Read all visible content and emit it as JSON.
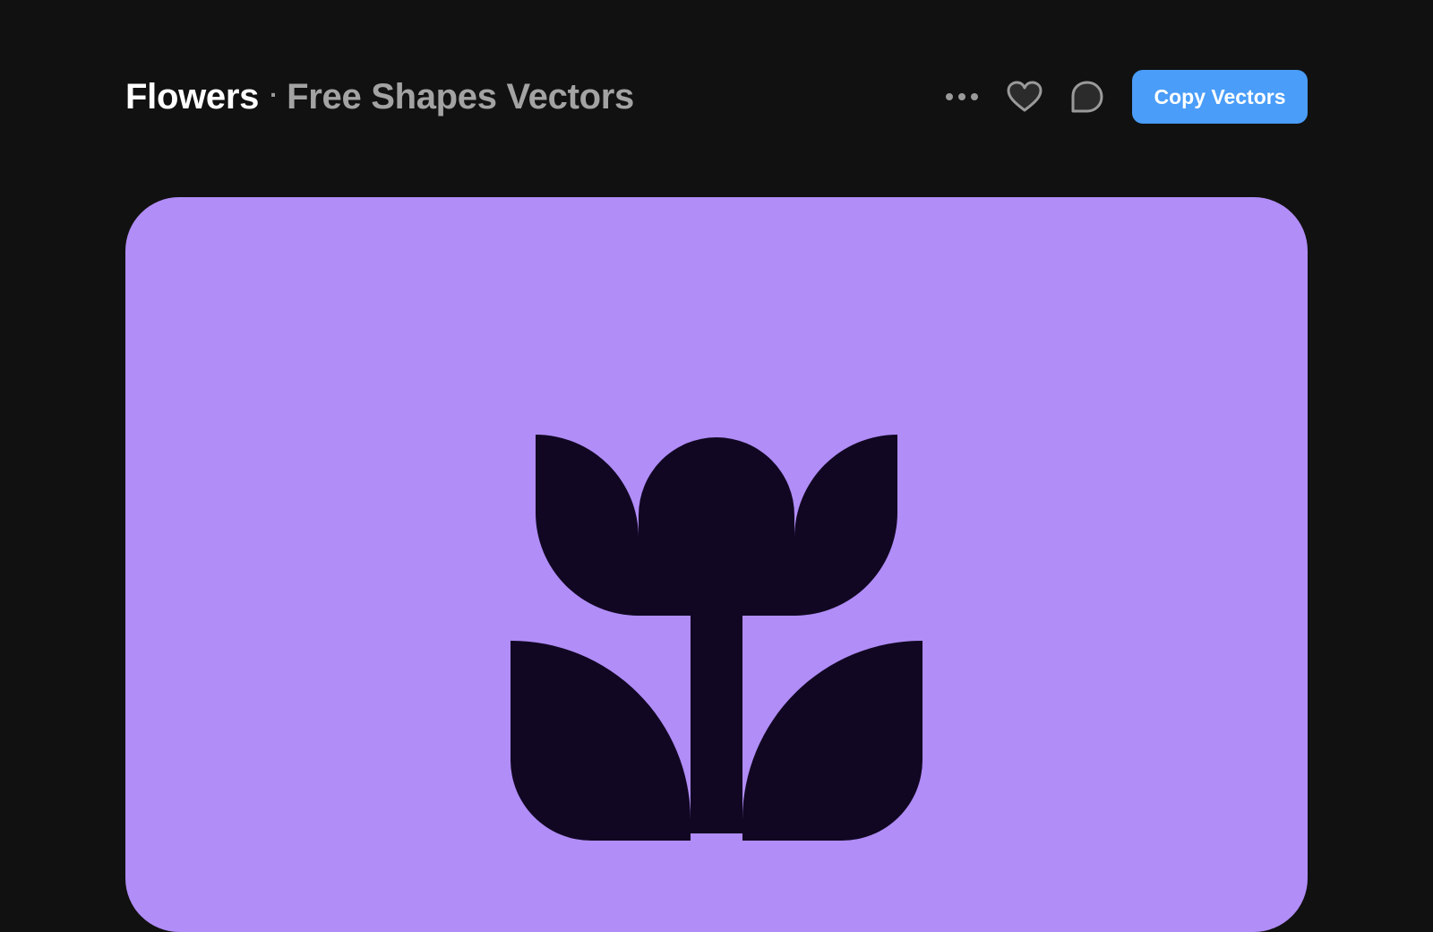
{
  "header": {
    "title": "Flowers",
    "separator": "·",
    "subtitle": "Free Shapes Vectors"
  },
  "actions": {
    "more_icon": "more-dots-icon",
    "like_icon": "heart-icon",
    "comment_icon": "comment-bubble-icon",
    "copy_label": "Copy Vectors"
  },
  "colors": {
    "background": "#111111",
    "accent": "#4a9df8",
    "preview_bg": "#b18df7",
    "shape_fill": "#110723"
  }
}
